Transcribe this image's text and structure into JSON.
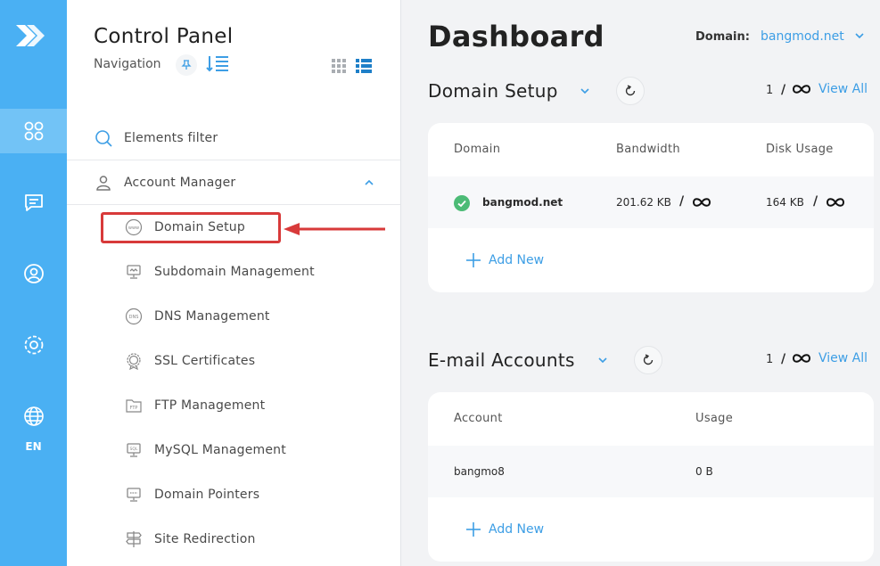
{
  "rail": {
    "items": [
      {
        "name": "dashboard",
        "icon": "dashboard-grid-icon"
      },
      {
        "name": "messages",
        "icon": "message-icon"
      },
      {
        "name": "account",
        "icon": "user-circle-icon"
      },
      {
        "name": "settings",
        "icon": "gear-icon"
      },
      {
        "name": "language",
        "icon": "globe-icon"
      }
    ],
    "lang": "EN",
    "accent": "#4ab0f3"
  },
  "nav": {
    "title": "Control Panel",
    "subtitle": "Navigation",
    "filter_label": "Elements filter",
    "group_label": "Account Manager",
    "items": [
      {
        "label": "Domain Setup",
        "icon": "www-globe-icon"
      },
      {
        "label": "Subdomain Management",
        "icon": "monitor-icon"
      },
      {
        "label": "DNS Management",
        "icon": "dns-icon"
      },
      {
        "label": "SSL Certificates",
        "icon": "certificate-icon"
      },
      {
        "label": "FTP Management",
        "icon": "ftp-folder-icon"
      },
      {
        "label": "MySQL Management",
        "icon": "database-icon"
      },
      {
        "label": "Domain Pointers",
        "icon": "monitor-pointer-icon"
      },
      {
        "label": "Site Redirection",
        "icon": "signpost-icon"
      }
    ],
    "highlight_color": "#d83a3a"
  },
  "header": {
    "title": "Dashboard",
    "domain_label": "Domain:",
    "domain_value": "bangmod.net"
  },
  "domain_setup": {
    "title": "Domain Setup",
    "pager_page": "1",
    "pager_slash": "/",
    "view_all": "View All",
    "columns": [
      "Domain",
      "Bandwidth",
      "Disk Usage"
    ],
    "row": {
      "domain": "bangmod.net",
      "bandwidth": "201.62 KB",
      "slash": "/",
      "disk": "164 KB"
    },
    "add_new": "Add New"
  },
  "email_accounts": {
    "title": "E-mail Accounts",
    "pager_page": "1",
    "pager_slash": "/",
    "view_all": "View All",
    "columns": [
      "Account",
      "Usage"
    ],
    "row": {
      "account": "bangmo8",
      "usage": "0 B"
    },
    "add_new": "Add New"
  },
  "colors": {
    "link": "#3d9ee5",
    "success": "#4cbb76"
  }
}
